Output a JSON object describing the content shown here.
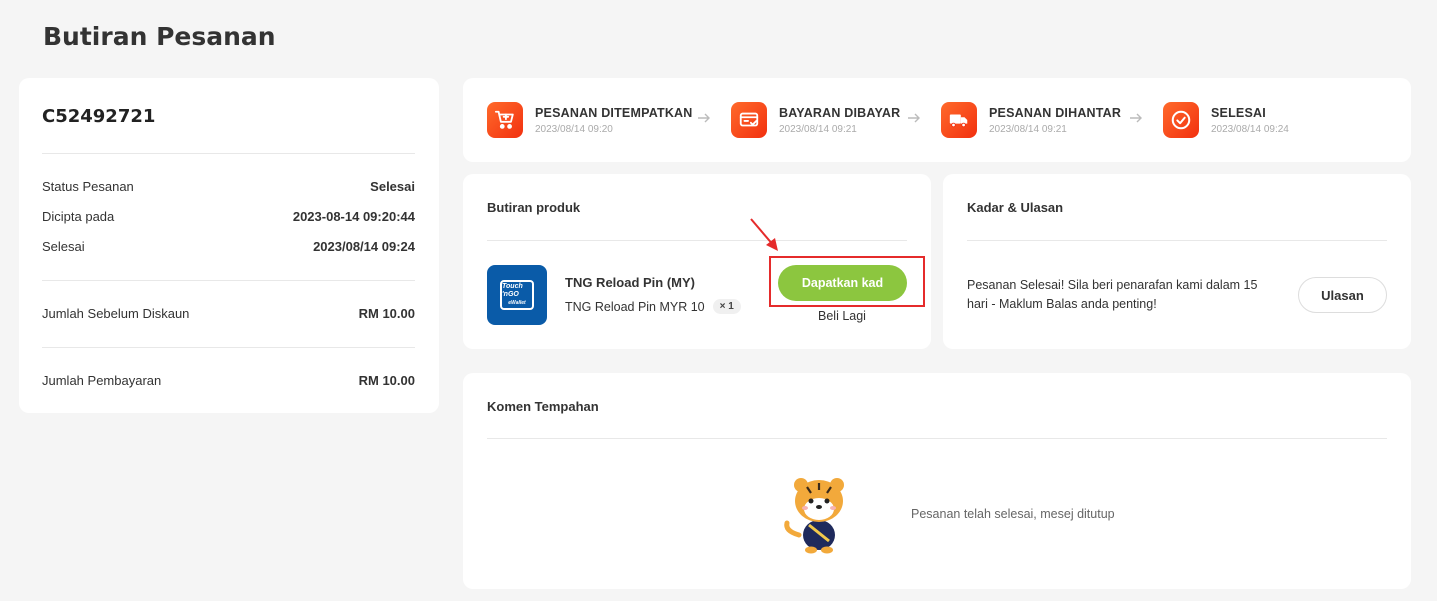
{
  "page": {
    "title": "Butiran Pesanan"
  },
  "summary": {
    "order_id": "C52492721",
    "rows": [
      {
        "label": "Status Pesanan",
        "value": "Selesai"
      },
      {
        "label": "Dicipta pada",
        "value": "2023-08-14 09:20:44"
      },
      {
        "label": "Selesai",
        "value": "2023/08/14 09:24"
      },
      {
        "label": "Jumlah Sebelum Diskaun",
        "value": "RM 10.00"
      },
      {
        "label": "Jumlah Pembayaran",
        "value": "RM 10.00"
      }
    ]
  },
  "progress": {
    "steps": [
      {
        "name": "PESANAN DITEMPATKAN",
        "time": "2023/08/14 09:20",
        "icon": "cart-icon"
      },
      {
        "name": "BAYARAN DIBAYAR",
        "time": "2023/08/14 09:21",
        "icon": "payment-card-icon"
      },
      {
        "name": "PESANAN DIHANTAR",
        "time": "2023/08/14 09:21",
        "icon": "truck-icon"
      },
      {
        "name": "SELESAI",
        "time": "2023/08/14 09:24",
        "icon": "check-circle-icon"
      }
    ],
    "accent": "#f54a1c"
  },
  "product": {
    "section_title": "Butiran produk",
    "image_text_top": "Touch 'nGO",
    "image_text_bottom": "eWallet",
    "name": "TNG Reload Pin (MY)",
    "variant": "TNG Reload Pin MYR 10",
    "qty": "× 1",
    "get_card_label": "Dapatkan kad",
    "buy_again_label": "Beli Lagi",
    "button_color": "#8cc63f",
    "highlight_color": "#e52b2b"
  },
  "rating": {
    "section_title": "Kadar & Ulasan",
    "message": "Pesanan Selesai! Sila beri penarafan kami dalam 15 hari - Maklum Balas anda penting!",
    "review_label": "Ulasan"
  },
  "comments": {
    "section_title": "Komen Tempahan",
    "closed_message": "Pesanan telah selesai, mesej ditutup"
  }
}
